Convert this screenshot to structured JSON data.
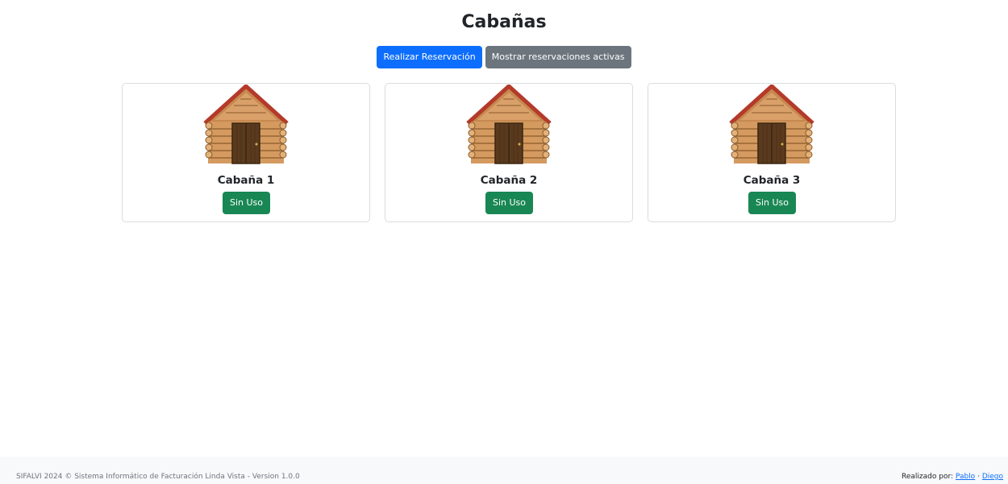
{
  "page": {
    "title": "Cabañas"
  },
  "actions": {
    "reserve_label": "Realizar Reservación",
    "show_active_label": "Mostrar reservaciones activas"
  },
  "cabins": [
    {
      "name": "Cabaña 1",
      "status": "Sin Uso",
      "icon": "log-cabin-icon"
    },
    {
      "name": "Cabaña 2",
      "status": "Sin Uso",
      "icon": "log-cabin-icon"
    },
    {
      "name": "Cabaña 3",
      "status": "Sin Uso",
      "icon": "log-cabin-icon"
    }
  ],
  "footer": {
    "left_text": "SIFALVI 2024 © Sistema Informático de Facturación Linda Vista - Version 1.0.0",
    "right_prefix": "Realizado por:",
    "author1": "Pablo",
    "separator": "·",
    "author2": "Diego"
  },
  "colors": {
    "primary": "#0d6efd",
    "secondary": "#6c757d",
    "success": "#198754"
  }
}
